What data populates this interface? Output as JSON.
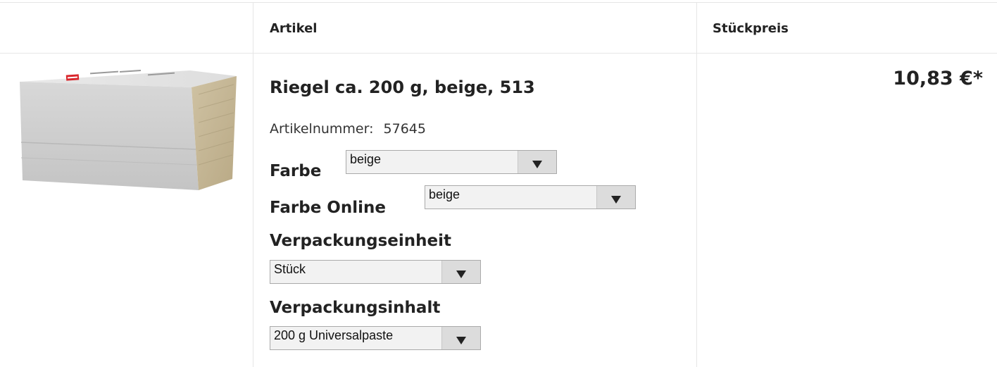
{
  "header": {
    "col_artikel": "Artikel",
    "col_stueckpreis": "Stückpreis"
  },
  "product": {
    "image_name": "product-packaging-image",
    "title": "Riegel ca. 200 g, beige, 513",
    "article_number_label": "Artikelnummer:",
    "article_number": "57645",
    "price": "10,83 €*"
  },
  "options": {
    "farbe": {
      "label": "Farbe",
      "selected": "beige"
    },
    "farbe_online": {
      "label": "Farbe Online",
      "selected": "beige"
    },
    "verpackungseinheit": {
      "label": "Verpackungseinheit",
      "selected": "Stück"
    },
    "verpackungsinhalt": {
      "label": "Verpackungsinhalt",
      "selected": "200 g Universalpaste"
    }
  },
  "colors": {
    "border": "#e6e6e6",
    "select_bg": "#f2f2f2",
    "select_button": "#dcdcdc",
    "text": "#222222"
  }
}
